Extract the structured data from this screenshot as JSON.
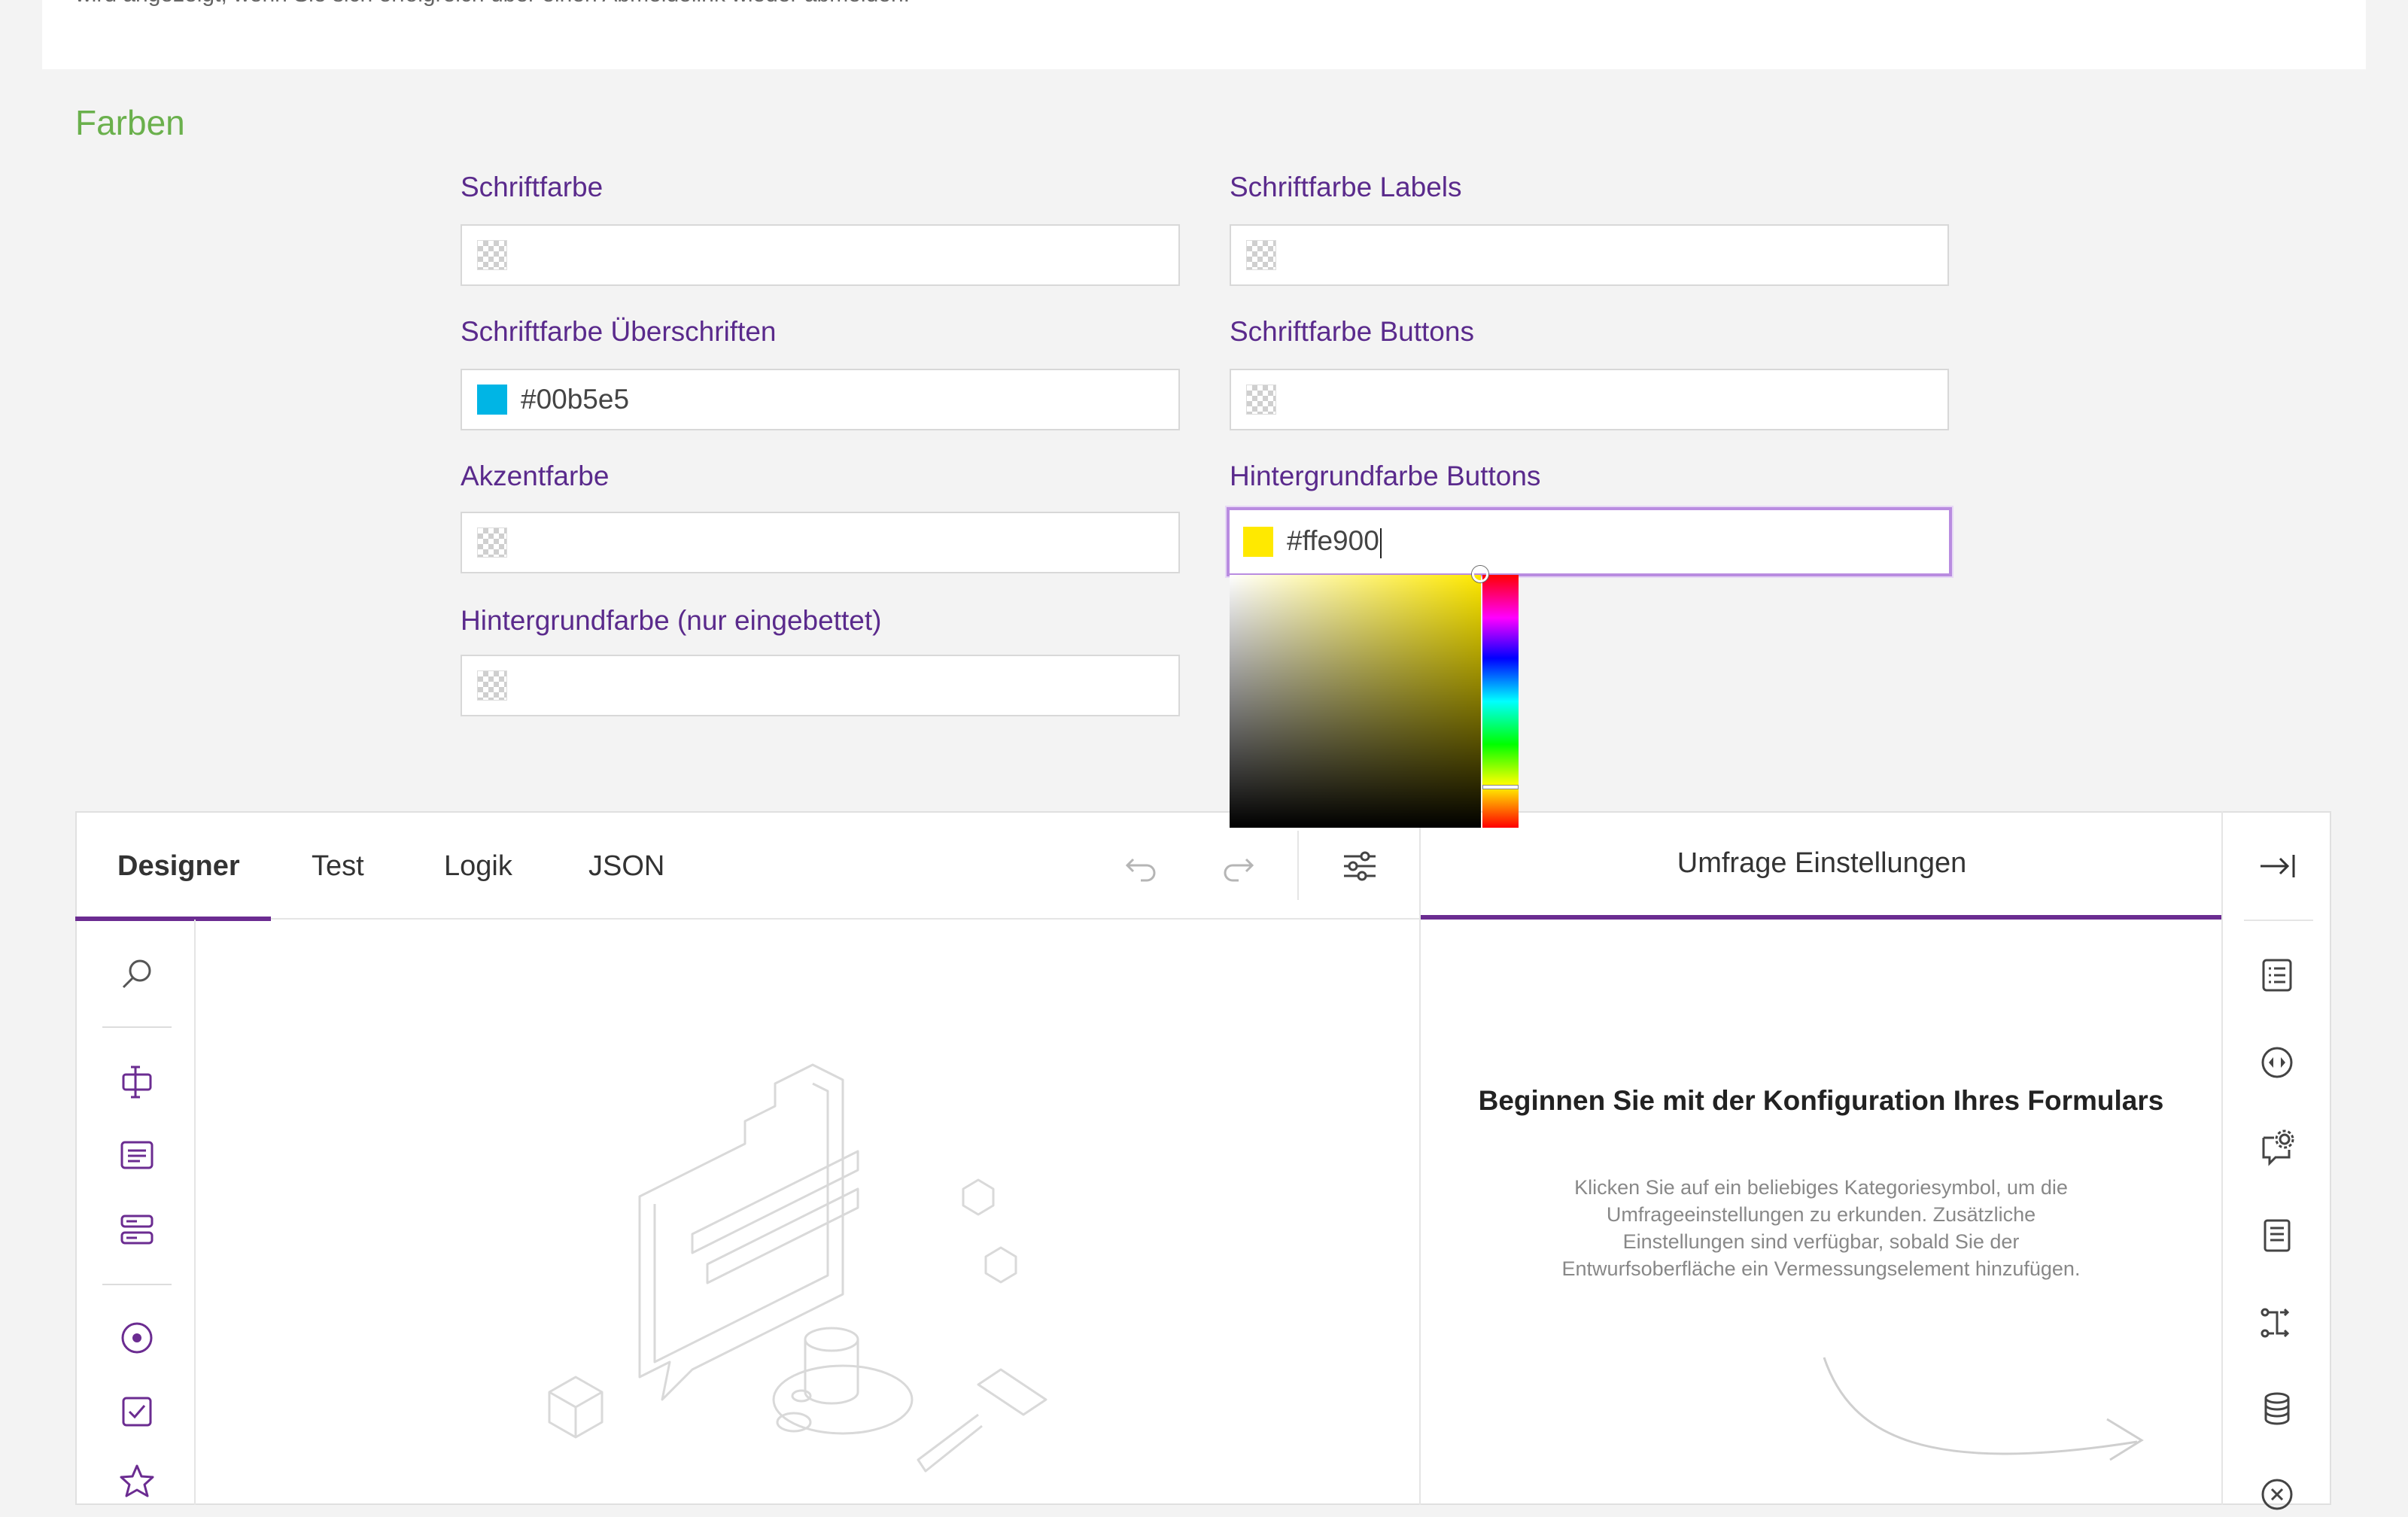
{
  "top_text": "wird angezeigt, wenn Sie sich erfolgreich über einen Abmeldelink wieder abmelden.",
  "section_title": "Farben",
  "fields": [
    {
      "label": "Schriftfarbe",
      "value": "",
      "color": ""
    },
    {
      "label": "Schriftfarbe Labels",
      "value": "",
      "color": ""
    },
    {
      "label": "Schriftfarbe Überschriften",
      "value": "#00b5e5",
      "color": "#00b5e5"
    },
    {
      "label": "Schriftfarbe Buttons",
      "value": "",
      "color": ""
    },
    {
      "label": "Akzentfarbe",
      "value": "",
      "color": ""
    },
    {
      "label": "Hintergrundfarbe Buttons",
      "value": "#ffe900",
      "color": "#ffe900"
    },
    {
      "label": "Hintergrundfarbe (nur eingebettet)",
      "value": "",
      "color": ""
    }
  ],
  "tabs": [
    {
      "label": "Designer",
      "active": true
    },
    {
      "label": "Test",
      "active": false
    },
    {
      "label": "Logik",
      "active": false
    },
    {
      "label": "JSON",
      "active": false
    }
  ],
  "toolbar": {
    "undo_icon": "undo-icon",
    "redo_icon": "redo-icon",
    "settings_icon": "sliders-icon"
  },
  "properties_panel": {
    "header": "Umfrage Einstellungen",
    "title": "Beginnen Sie mit der Konfiguration Ihres Formulars",
    "description": "Klicken Sie auf ein beliebiges Kategoriesymbol, um die Umfrageeinstellungen zu erkunden. Zusätzliche Einstellungen sind verfügbar, sobald Sie der Entwurfsoberfläche ein Vermessungselement hinzufügen.",
    "collapse_icon": "collapse-right-icon"
  },
  "toolbox_icons": [
    "search-icon",
    "text-input-icon",
    "comment-icon",
    "multiple-text-icon",
    "radio-icon",
    "checkbox-icon",
    "rating-icon"
  ],
  "side_category_icons": [
    "general-icon",
    "logic-icon",
    "questions-settings-icon",
    "pages-icon",
    "navigation-icon",
    "data-icon",
    "validation-icon"
  ],
  "colors": {
    "accent": "#6b2c91",
    "section_title": "#6ab04c",
    "label": "#5a2a8c"
  }
}
